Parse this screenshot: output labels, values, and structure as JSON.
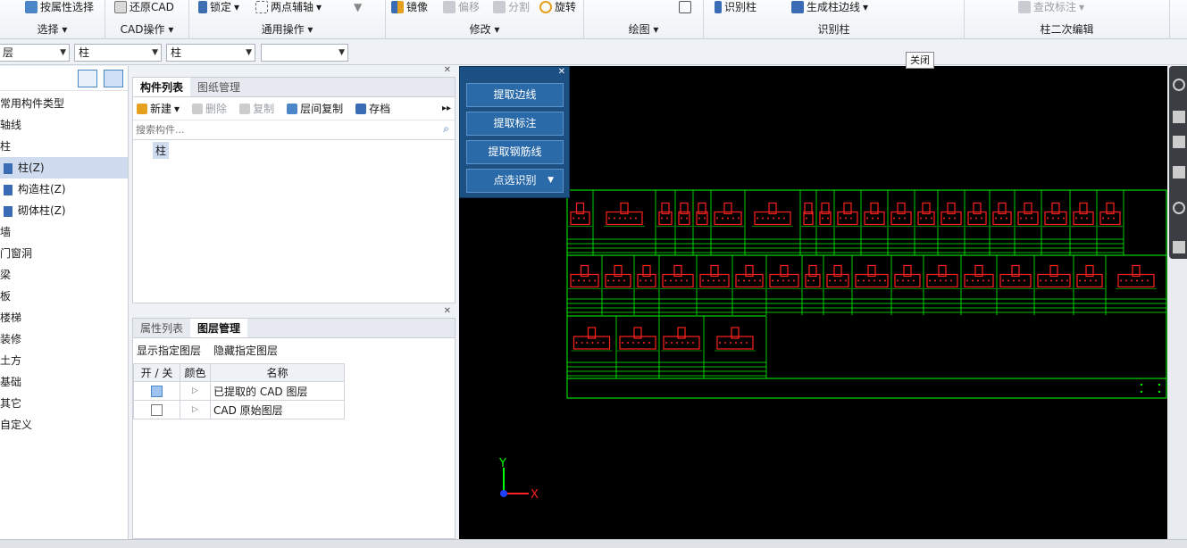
{
  "ribbon": {
    "select": {
      "top_button": "按属性选择",
      "label": "选择"
    },
    "cad": {
      "top_button": "还原CAD",
      "label": "CAD操作"
    },
    "general": {
      "lock": "锁定",
      "axis": "两点辅轴",
      "label": "通用操作"
    },
    "modify": {
      "mirror": "镜像",
      "offset": "偏移",
      "split": "分割",
      "rotate": "旋转",
      "label": "修改"
    },
    "draw": {
      "label": "绘图"
    },
    "identify": {
      "identify_column": "识别柱",
      "gen_edge": "生成柱边线",
      "label": "识别柱"
    },
    "secondary": {
      "edit_annotation": "查改标注",
      "label": "柱二次编辑"
    }
  },
  "toolbar": {
    "floor_value": "层",
    "type_value": "柱",
    "name_value": "柱",
    "extra_value": ""
  },
  "tree": {
    "items": [
      {
        "label": "常用构件类型",
        "indent": 0
      },
      {
        "label": "轴线",
        "indent": 0
      },
      {
        "label": "柱",
        "indent": 0
      },
      {
        "label": "柱(Z)",
        "indent": 1,
        "selected": true
      },
      {
        "label": "构造柱(Z)",
        "indent": 1
      },
      {
        "label": "砌体柱(Z)",
        "indent": 1
      },
      {
        "label": "墙",
        "indent": 0
      },
      {
        "label": "门窗洞",
        "indent": 0
      },
      {
        "label": "梁",
        "indent": 0
      },
      {
        "label": "板",
        "indent": 0
      },
      {
        "label": "楼梯",
        "indent": 0
      },
      {
        "label": "装修",
        "indent": 0
      },
      {
        "label": "土方",
        "indent": 0
      },
      {
        "label": "基础",
        "indent": 0
      },
      {
        "label": "其它",
        "indent": 0
      },
      {
        "label": "自定义",
        "indent": 0
      }
    ]
  },
  "component_panel": {
    "tabs": [
      "构件列表",
      "图纸管理"
    ],
    "actions": {
      "new": "新建",
      "delete": "删除",
      "copy": "复制",
      "floor_copy": "层间复制",
      "save": "存档"
    },
    "search_placeholder": "搜索构件...",
    "items": [
      "柱"
    ]
  },
  "layer_panel": {
    "tabs": [
      "属性列表",
      "图层管理"
    ],
    "show_layer": "显示指定图层",
    "hide_layer": "隐藏指定图层",
    "headers": {
      "toggle": "开 / 关",
      "color": "颜色",
      "name": "名称"
    },
    "rows": [
      {
        "name": "已提取的 CAD 图层",
        "checked": true
      },
      {
        "name": "CAD 原始图层",
        "checked": false
      }
    ]
  },
  "extract_dialog": {
    "buttons": [
      "提取边线",
      "提取标注",
      "提取钢筋线",
      "点选识别"
    ]
  },
  "tooltip": {
    "text": "关闭"
  },
  "axes": {
    "x": "X",
    "y": "Y"
  },
  "colors": {
    "cad_green": "#00ff00",
    "cad_red": "#ff2020",
    "dialog_blue": "#1c4f82"
  }
}
